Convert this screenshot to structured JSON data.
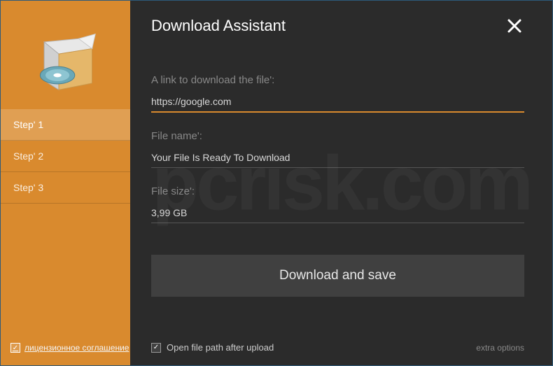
{
  "title": "Download Assistant",
  "sidebar": {
    "steps": [
      {
        "label": "Step' 1",
        "active": true
      },
      {
        "label": "Step' 2",
        "active": false
      },
      {
        "label": "Step' 3",
        "active": false
      }
    ],
    "license_label": "лицензионное соглашение",
    "license_checked": true
  },
  "fields": {
    "link_label": "A link to download the file':",
    "link_value": "https://google.com",
    "filename_label": "File name':",
    "filename_value": "Your File Is Ready To Download",
    "filesize_label": "File size':",
    "filesize_value": "3,99 GB"
  },
  "download_button": "Download and save",
  "footer": {
    "open_path_label": "Open file path after upload",
    "open_path_checked": true,
    "extra_options": "extra options"
  },
  "checkmark": "✓"
}
